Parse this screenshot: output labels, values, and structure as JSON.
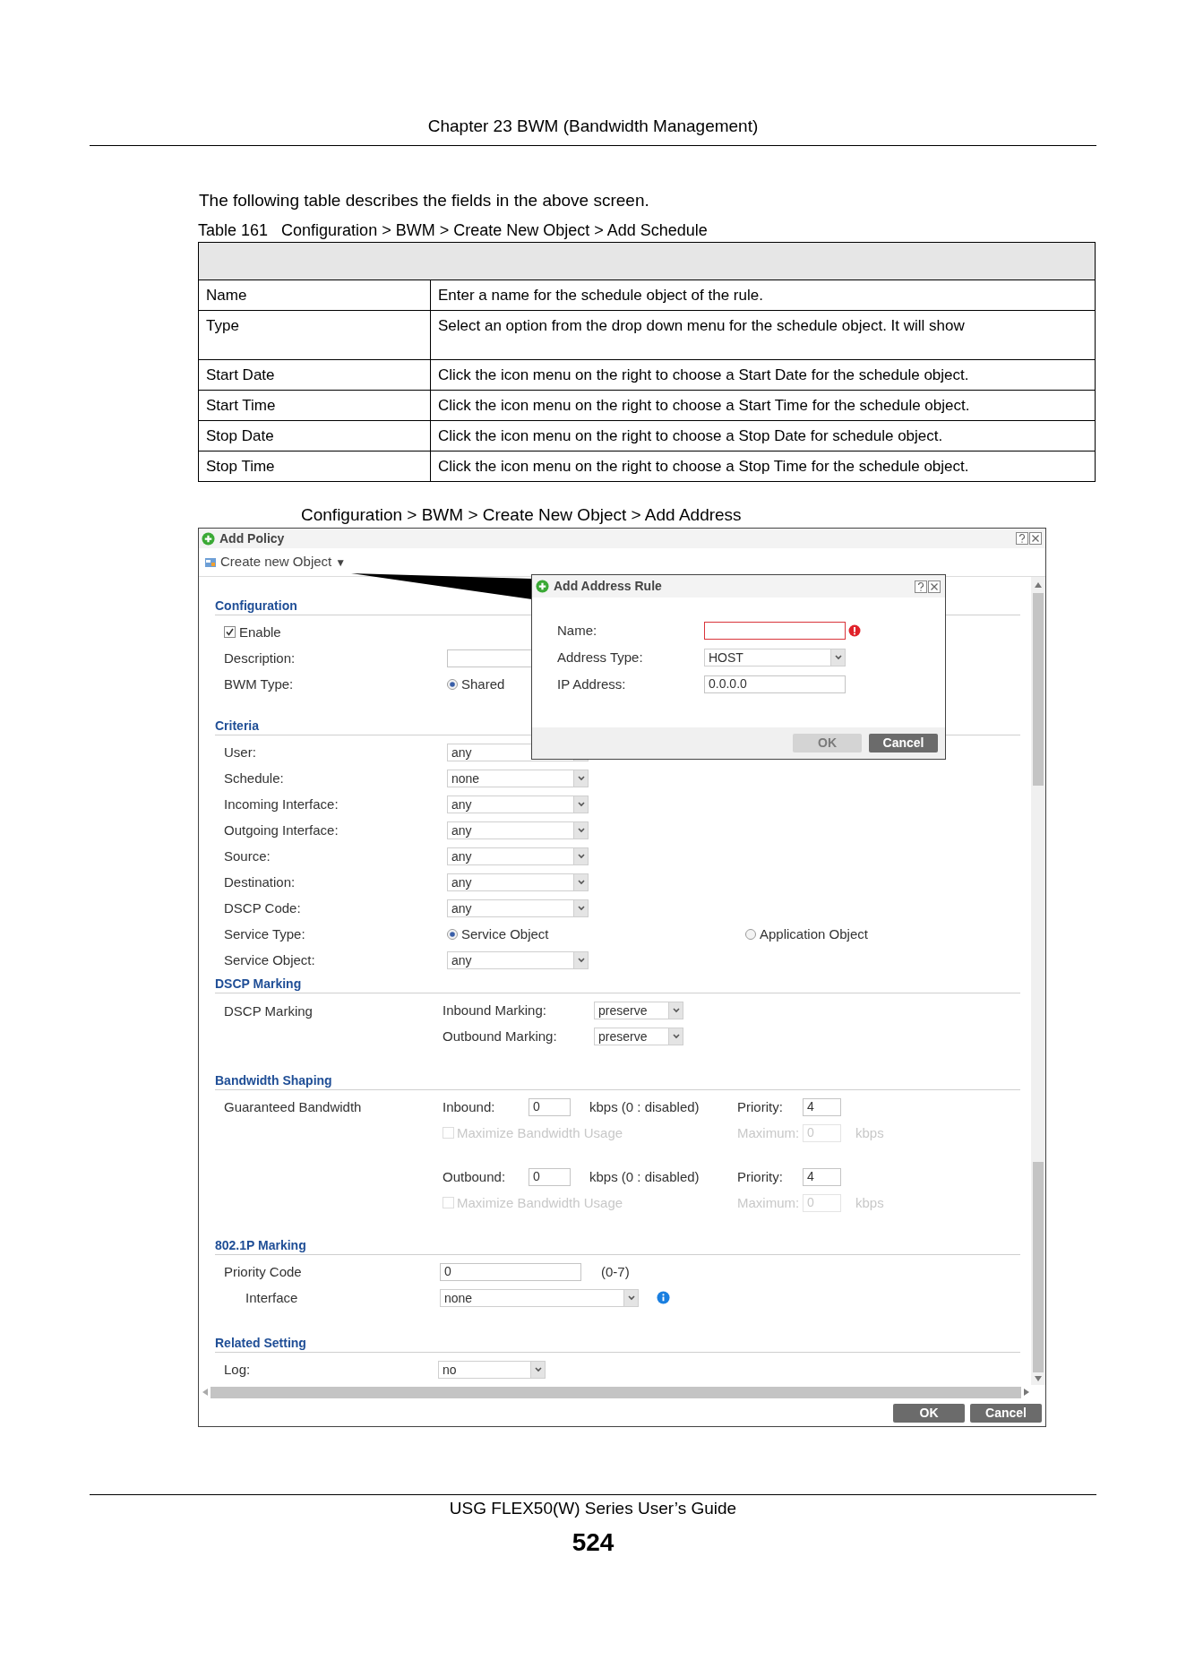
{
  "header": {
    "chapter": "Chapter 23 BWM (Bandwidth Management)"
  },
  "intro": "The following table describes the fields in the above screen.",
  "table": {
    "caption": "Table 161   Configuration > BWM > Create New Object > Add Schedule",
    "rows": [
      {
        "label": "Name",
        "description": "Enter a name for the schedule object of the rule."
      },
      {
        "label": "Type",
        "description": "Select an option from the drop down menu for the schedule object. It will show"
      },
      {
        "label": "Start Date",
        "description": "Click the icon menu on the right to choose a Start Date for the schedule object."
      },
      {
        "label": "Start Time",
        "description": "Click the icon menu on the right to choose a Start Time for the schedule object."
      },
      {
        "label": "Stop Date",
        "description": "Click the icon menu on the right to choose a Stop Date for schedule object."
      },
      {
        "label": "Stop Time",
        "description": "Click the icon menu on the right to choose a Stop Time for the schedule object."
      }
    ]
  },
  "figure": {
    "caption": "Configuration > BWM > Create New Object > Add Address",
    "window": {
      "title": "Add Policy",
      "menu_button": {
        "label": "Create new Object",
        "caret": "▼"
      },
      "sections": [
        {
          "title": "Configuration",
          "rows": [
            {
              "kind": "checkbox",
              "label": "Enable",
              "checked": true
            },
            {
              "kind": "text",
              "label": "Description:"
            },
            {
              "kind": "radio",
              "label": "BWM Type:",
              "options": [
                {
                  "label": "Shared",
                  "selected": true
                }
              ]
            }
          ]
        },
        {
          "title": "Criteria",
          "rows": [
            {
              "kind": "select",
              "label": "User:",
              "value": "any"
            },
            {
              "kind": "select",
              "label": "Schedule:",
              "value": "none"
            },
            {
              "kind": "select",
              "label": "Incoming Interface:",
              "value": "any"
            },
            {
              "kind": "select",
              "label": "Outgoing Interface:",
              "value": "any"
            },
            {
              "kind": "select",
              "label": "Source:",
              "value": "any"
            },
            {
              "kind": "select",
              "label": "Destination:",
              "value": "any"
            },
            {
              "kind": "select",
              "label": "DSCP Code:",
              "value": "any"
            },
            {
              "kind": "radio",
              "label": "Service Type:",
              "options": [
                {
                  "label": "Service Object",
                  "selected": true
                },
                {
                  "label": "Application Object",
                  "selected": false
                }
              ]
            },
            {
              "kind": "select",
              "label": "Service Object:",
              "value": "any"
            }
          ]
        },
        {
          "title": "DSCP Marking",
          "rows": [
            {
              "kind": "marking",
              "label": "DSCP Marking",
              "fields": [
                {
                  "label": "Inbound Marking:",
                  "value": "preserve"
                },
                {
                  "label": "Outbound Marking:",
                  "value": "preserve"
                }
              ]
            }
          ]
        },
        {
          "title": "Bandwidth Shaping",
          "rows": [
            {
              "kind": "bandwidth",
              "label": "Guaranteed Bandwidth",
              "directions": [
                {
                  "label": "Inbound:",
                  "value": "0",
                  "unit": "kbps (0 : disabled)",
                  "priority_label": "Priority:",
                  "priority": "4",
                  "maximize": {
                    "label": "Maximize Bandwidth Usage",
                    "checked": false,
                    "disabled": true
                  },
                  "maximum_label": "Maximum:",
                  "maximum": "0",
                  "maximum_unit": "kbps"
                },
                {
                  "label": "Outbound:",
                  "value": "0",
                  "unit": "kbps (0 : disabled)",
                  "priority_label": "Priority:",
                  "priority": "4",
                  "maximize": {
                    "label": "Maximize Bandwidth Usage",
                    "checked": false,
                    "disabled": true
                  },
                  "maximum_label": "Maximum:",
                  "maximum": "0",
                  "maximum_unit": "kbps"
                }
              ]
            }
          ]
        },
        {
          "title": "802.1P Marking",
          "rows": [
            {
              "kind": "text",
              "label": "Priority Code",
              "value": "0",
              "hint": "(0-7)"
            },
            {
              "kind": "select",
              "label": "Interface",
              "value": "none",
              "info": true
            }
          ]
        },
        {
          "title": "Related Setting",
          "rows": [
            {
              "kind": "select",
              "label": "Log:",
              "value": "no"
            }
          ]
        }
      ],
      "buttons": [
        {
          "label": "OK",
          "disabled": false
        },
        {
          "label": "Cancel",
          "disabled": false
        }
      ],
      "dialog": {
        "title": "Add Address Rule",
        "fields": [
          {
            "kind": "text",
            "label": "Name:",
            "error": true
          },
          {
            "kind": "select",
            "label": "Address Type:",
            "value": "HOST"
          },
          {
            "kind": "text",
            "label": "IP Address:",
            "value": "0.0.0.0",
            "error": false
          }
        ],
        "buttons": [
          {
            "label": "OK",
            "disabled": true
          },
          {
            "label": "Cancel",
            "disabled": false
          }
        ]
      }
    }
  },
  "footer": {
    "guide": "USG FLEX50(W) Series User’s Guide",
    "page": "524"
  }
}
